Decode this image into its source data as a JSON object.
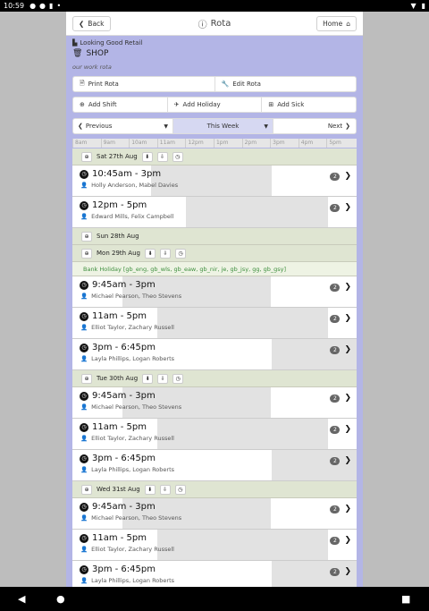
{
  "status": {
    "time": "10:59"
  },
  "topbar": {
    "back_label": "Back",
    "title": "Rota",
    "home_label": "Home"
  },
  "info": {
    "company": "Looking Good Retail",
    "shop": "SHOP",
    "description": "our work rota"
  },
  "actions": {
    "print": "Print Rota",
    "edit": "Edit Rota",
    "add_shift": "Add Shift",
    "add_holiday": "Add Holiday",
    "add_sick": "Add Sick"
  },
  "nav": {
    "previous": "Previous",
    "this_week": "This Week",
    "next": "Next"
  },
  "timescale": [
    "8am",
    "9am",
    "10am",
    "11am",
    "12pm",
    "1pm",
    "2pm",
    "3pm",
    "4pm",
    "5pm"
  ],
  "days": [
    {
      "label": "Sat 27th Aug",
      "shifts": [
        {
          "time": "10:45am - 3pm",
          "people": "Holly Anderson, Mabel Davies",
          "count": "2"
        },
        {
          "time": "12pm - 5pm",
          "people": "Edward Mills, Felix Campbell",
          "count": "2"
        }
      ]
    },
    {
      "label": "Sun 28th Aug",
      "shifts": []
    },
    {
      "label": "Mon 29th Aug",
      "holiday": "Bank Holiday [gb_eng, gb_wls, gb_eaw, gb_nir, je, gb_jsy, gg, gb_gsy]",
      "shifts": [
        {
          "time": "9:45am - 3pm",
          "people": "Michael Pearson, Theo Stevens",
          "count": "2"
        },
        {
          "time": "11am - 5pm",
          "people": "Elliot Taylor, Zachary Russell",
          "count": "2"
        },
        {
          "time": "3pm - 6:45pm",
          "people": "Layla Phillips, Logan Roberts",
          "count": "2"
        }
      ]
    },
    {
      "label": "Tue 30th Aug",
      "shifts": [
        {
          "time": "9:45am - 3pm",
          "people": "Michael Pearson, Theo Stevens",
          "count": "2"
        },
        {
          "time": "11am - 5pm",
          "people": "Elliot Taylor, Zachary Russell",
          "count": "2"
        },
        {
          "time": "3pm - 6:45pm",
          "people": "Layla Phillips, Logan Roberts",
          "count": "2"
        }
      ]
    },
    {
      "label": "Wed 31st Aug",
      "shifts": [
        {
          "time": "9:45am - 3pm",
          "people": "Michael Pearson, Theo Stevens",
          "count": "2"
        },
        {
          "time": "11am - 5pm",
          "people": "Elliot Taylor, Zachary Russell",
          "count": "2"
        },
        {
          "time": "3pm - 6:45pm",
          "people": "Layla Phillips, Logan Roberts",
          "count": "2"
        }
      ]
    }
  ]
}
